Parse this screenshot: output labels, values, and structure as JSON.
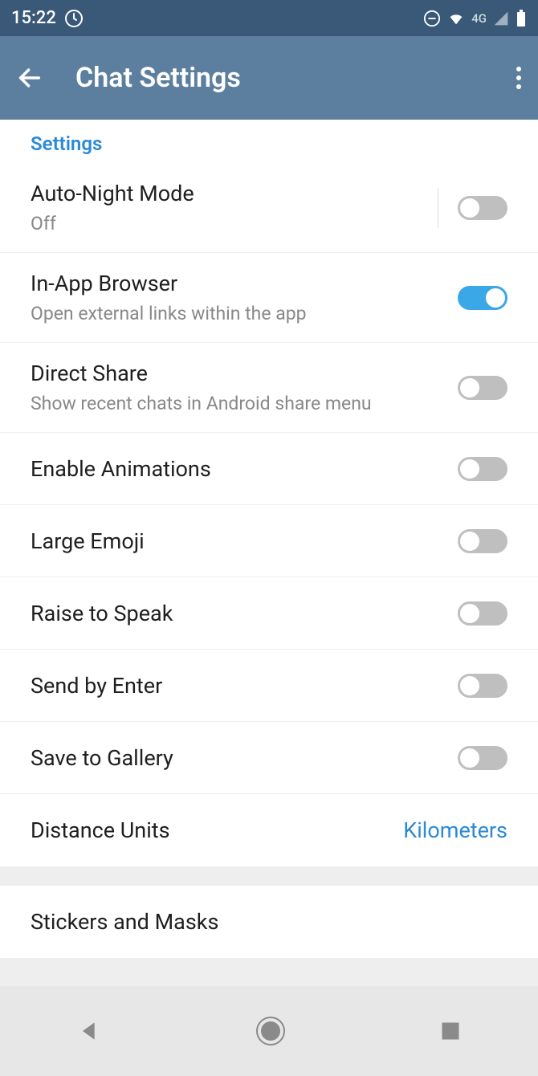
{
  "status": {
    "time": "15:22",
    "network": "4G"
  },
  "header": {
    "title": "Chat Settings"
  },
  "section_label": "Settings",
  "rows": {
    "auto_night": {
      "title": "Auto-Night Mode",
      "sub": "Off"
    },
    "inapp_browser": {
      "title": "In-App Browser",
      "sub": "Open external links within the app"
    },
    "direct_share": {
      "title": "Direct Share",
      "sub": "Show recent chats in Android share menu"
    },
    "enable_anim": {
      "title": "Enable Animations"
    },
    "large_emoji": {
      "title": "Large Emoji"
    },
    "raise_speak": {
      "title": "Raise to Speak"
    },
    "send_enter": {
      "title": "Send by Enter"
    },
    "save_gallery": {
      "title": "Save to Gallery"
    },
    "distance": {
      "title": "Distance Units",
      "value": "Kilometers"
    },
    "stickers": {
      "title": "Stickers and Masks"
    }
  }
}
